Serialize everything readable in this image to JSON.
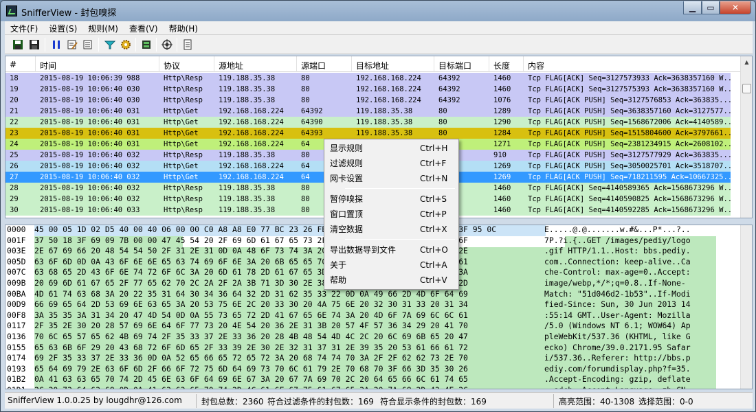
{
  "window": {
    "title": "SnifferView - 封包嗅探"
  },
  "menu": [
    "文件(F)",
    "设置(S)",
    "规则(M)",
    "查看(V)",
    "帮助(H)"
  ],
  "table": {
    "headers": [
      "#",
      "时间",
      "协议",
      "源地址",
      "源端口",
      "目标地址",
      "目标端口",
      "长度",
      "内容"
    ],
    "rows": [
      {
        "c": [
          "18",
          "2015-08-19 10:06:39 988",
          "Http\\Resp",
          "119.188.35.38",
          "80",
          "192.168.168.224",
          "64392",
          "1460",
          "Tcp FLAG[ACK] Seq=3127573933 Ack=3638357160 W..."
        ],
        "bg": "#c8c8f5"
      },
      {
        "c": [
          "19",
          "2015-08-19 10:06:40 030",
          "Http\\Resp",
          "119.188.35.38",
          "80",
          "192.168.168.224",
          "64392",
          "1460",
          "Tcp FLAG[ACK] Seq=3127575393 Ack=3638357160 W..."
        ],
        "bg": "#c8c8f5"
      },
      {
        "c": [
          "20",
          "2015-08-19 10:06:40 030",
          "Http\\Resp",
          "119.188.35.38",
          "80",
          "192.168.168.224",
          "64392",
          "1076",
          "Tcp FLAG[ACK PUSH] Seq=3127576853 Ack=363835..."
        ],
        "bg": "#c8c8f5"
      },
      {
        "c": [
          "21",
          "2015-08-19 10:06:40 031",
          "Http\\Get",
          "192.168.168.224",
          "64392",
          "119.188.35.38",
          "80",
          "1289",
          "Tcp FLAG[ACK PUSH] Seq=3638357160 Ack=3127577..."
        ],
        "bg": "#c8c8f5"
      },
      {
        "c": [
          "22",
          "2015-08-19 10:06:40 031",
          "Http\\Get",
          "192.168.168.224",
          "64390",
          "119.188.35.38",
          "80",
          "1290",
          "Tcp FLAG[ACK PUSH] Seq=1568672006 Ack=4140589..."
        ],
        "bg": "#c9f0c9"
      },
      {
        "c": [
          "23",
          "2015-08-19 10:06:40 031",
          "Http\\Get",
          "192.168.168.224",
          "64393",
          "119.188.35.38",
          "80",
          "1284",
          "Tcp FLAG[ACK PUSH] Seq=1515804600 Ack=3797661..."
        ],
        "bg": "#d8c010"
      },
      {
        "c": [
          "24",
          "2015-08-19 10:06:40 031",
          "Http\\Get",
          "192.168.168.224",
          "64",
          "",
          "",
          "1271",
          "Tcp FLAG[ACK PUSH] Seq=2381234915 Ack=2608102..."
        ],
        "bg": "#bff07a"
      },
      {
        "c": [
          "25",
          "2015-08-19 10:06:40 032",
          "Http\\Resp",
          "119.188.35.38",
          "80",
          "",
          "",
          "910",
          "Tcp FLAG[ACK PUSH] Seq=3127577929 Ack=363835..."
        ],
        "bg": "#c8c8f5"
      },
      {
        "c": [
          "26",
          "2015-08-19 10:06:40 032",
          "Http\\Get",
          "192.168.168.224",
          "64",
          "",
          "",
          "1269",
          "Tcp FLAG[ACK PUSH] Seq=3050025701 Ack=3518707..."
        ],
        "bg": "#b4dff5"
      },
      {
        "c": [
          "27",
          "2015-08-19 10:06:40 032",
          "Http\\Get",
          "192.168.168.224",
          "64",
          "",
          "",
          "1269",
          "Tcp FLAG[ACK PUSH] Seq=718211595 Ack=10667325..."
        ],
        "bg": "#3399ff",
        "sel": true
      },
      {
        "c": [
          "28",
          "2015-08-19 10:06:40 032",
          "Http\\Resp",
          "119.188.35.38",
          "80",
          "",
          "",
          "1460",
          "Tcp FLAG[ACK] Seq=4140589365 Ack=1568673296 W..."
        ],
        "bg": "#c9f0c9"
      },
      {
        "c": [
          "29",
          "2015-08-19 10:06:40 032",
          "Http\\Resp",
          "119.188.35.38",
          "80",
          "",
          "",
          "1460",
          "Tcp FLAG[ACK] Seq=4140590825 Ack=1568673296 W..."
        ],
        "bg": "#c9f0c9"
      },
      {
        "c": [
          "30",
          "2015-08-19 10:06:40 033",
          "Http\\Resp",
          "119.188.35.38",
          "80",
          "",
          "",
          "1460",
          "Tcp FLAG[ACK] Seq=4140592285 Ack=1568673296 W..."
        ],
        "bg": "#c9f0c9"
      }
    ]
  },
  "hex": [
    {
      "o": "0000",
      "b": "45 00 05 1D 02 D5 40 00 40 06 00 00 C0 A8 A8 E0 77 BC 23 26 FB 8F 00 50 BE 8E 99 89 0A 0B 3F 95 0C",
      "a": "E.....@.@.......w.#&...P*...?.."
    },
    {
      "o": "001F",
      "b": "37 50 18 3F 69 09 7B 00 00 47 45 54 20 2F 69 6D 61 67 65 73 2F 70 65 64 69 79 2F 6C 6F 67 6F",
      "a": "7P.?i.{..GET /images/pediy/logo"
    },
    {
      "o": "003E",
      "b": "2E 67 69 66 20 48 54 54 50 2F 31 2E 31 0D 0A 48 6F 73 74 3A 20 62 62 73 2E 70 65 64 69 79 2E",
      "a": ".gif HTTP/1.1..Host: bbs.pediy."
    },
    {
      "o": "005D",
      "b": "63 6F 6D 0D 0A 43 6F 6E 6E 65 63 74 69 6F 6E 3A 20 6B 65 65 70 2D 61 6C 69 76 65 0D 0A 43 61",
      "a": "com..Connection: keep-alive..Ca"
    },
    {
      "o": "007C",
      "b": "63 68 65 2D 43 6F 6E 74 72 6F 6C 3A 20 6D 61 78 2D 61 67 65 3D 30 0D 0A 41 63 63 65 70 74 3A",
      "a": "che-Control: max-age=0..Accept:"
    },
    {
      "o": "009B",
      "b": "20 69 6D 61 67 65 2F 77 65 62 70 2C 2A 2F 2A 3B 71 3D 30 2E 38 0D 0A 49 66 2D 4E 6F 6E 65 2D",
      "a": " image/webp,*/*;q=0.8..If-None-"
    },
    {
      "o": "00BA",
      "b": "4D 61 74 63 68 3A 20 22 35 31 64 30 34 36 64 32 2D 31 62 35 33 22 0D 0A 49 66 2D 4D 6F 64 69",
      "a": "Match: \"51d046d2-1b53\"..If-Modi"
    },
    {
      "o": "00D9",
      "b": "66 69 65 64 2D 53 69 6E 63 65 3A 20 53 75 6E 2C 20 33 30 20 4A 75 6E 20 32 30 31 33 20 31 34",
      "a": "fied-Since: Sun, 30 Jun 2013 14"
    },
    {
      "o": "00F8",
      "b": "3A 35 35 3A 31 34 20 47 4D 54 0D 0A 55 73 65 72 2D 41 67 65 6E 74 3A 20 4D 6F 7A 69 6C 6C 61",
      "a": ":55:14 GMT..User-Agent: Mozilla"
    },
    {
      "o": "0117",
      "b": "2F 35 2E 30 20 28 57 69 6E 64 6F 77 73 20 4E 54 20 36 2E 31 3B 20 57 4F 57 36 34 29 20 41 70",
      "a": "/5.0 (Windows NT 6.1; WOW64) Ap"
    },
    {
      "o": "0136",
      "b": "70 6C 65 57 65 62 4B 69 74 2F 35 33 37 2E 33 36 20 28 4B 48 54 4D 4C 2C 20 6C 69 6B 65 20 47",
      "a": "pleWebKit/537.36 (KHTML, like G"
    },
    {
      "o": "0155",
      "b": "65 63 6B 6F 29 20 43 68 72 6F 6D 65 2F 33 39 2E 30 2E 32 31 37 31 2E 39 35 20 53 61 66 61 72",
      "a": "ecko) Chrome/39.0.2171.95 Safar"
    },
    {
      "o": "0174",
      "b": "69 2F 35 33 37 2E 33 36 0D 0A 52 65 66 65 72 65 72 3A 20 68 74 74 70 3A 2F 2F 62 62 73 2E 70",
      "a": "i/537.36..Referer: http://bbs.p"
    },
    {
      "o": "0193",
      "b": "65 64 69 79 2E 63 6F 6D 2F 66 6F 72 75 6D 64 69 73 70 6C 61 79 2E 70 68 70 3F 66 3D 35 30 26",
      "a": "ediy.com/forumdisplay.php?f=35."
    },
    {
      "o": "01B2",
      "b": "0A 41 63 63 65 70 74 2D 45 6E 63 6F 64 69 6E 67 3A 20 67 7A 69 70 2C 20 64 65 66 6C 61 74 65",
      "a": ".Accept-Encoding: gzip, deflate"
    },
    {
      "o": "01D1",
      "b": "2C 20 73 64 63 68 0D 0A 41 63 63 65 70 74 2D 4C 61 6E 67 75 61 67 65 3A 20 7A 68 2D 43 4E 2C",
      "a": ", sdch..Accept-Language: zh-CN,"
    },
    {
      "o": "01F0",
      "b": "7A 68 3B 71 3D 30 2E 38 0D 0A 43 6F 6F 6B 69 65 3A 20 49 44 73 74 61 63 6B 3D 25 32 43 34 36",
      "a": "zh;q=0.8..Cookie: IDstack=%2C46"
    },
    {
      "o": "020F",
      "b": "38 37 32 38 25 32 43 3B 20 76 62 75 6C 6C 65 74 69 6E 5F 63 6F 6C 6C 61 70 73 65 3D 61 74 74",
      "a": "8728%2C; vbulletin_collapse=att"
    }
  ],
  "context_menu": [
    {
      "label": "显示规则",
      "shortcut": "Ctrl+H"
    },
    {
      "label": "过滤规则",
      "shortcut": "Ctrl+F"
    },
    {
      "label": "网卡设置",
      "shortcut": "Ctrl+N"
    },
    {
      "label": "暂停嗅探",
      "shortcut": "Ctrl+S"
    },
    {
      "label": "窗口置顶",
      "shortcut": "Ctrl+P"
    },
    {
      "label": "清空数据",
      "shortcut": "Ctrl+X"
    },
    {
      "label": "导出数据导到文件",
      "shortcut": "Ctrl+O"
    },
    {
      "label": "关于",
      "shortcut": "Ctrl+A"
    },
    {
      "label": "帮助",
      "shortcut": "Ctrl+V"
    }
  ],
  "status": {
    "app": "SnifferView  1.0.0.25  by  lougdhr@126.com",
    "total": "封包总数：2360",
    "filter": "符合过滤条件的封包数：169",
    "display": "符合显示条件的封包数：169",
    "range": "高亮范围：40-1308",
    "select": "选择范围：0-0"
  },
  "icons": [
    "save-icon",
    "save-all-icon",
    "pause-icon",
    "edit-icon",
    "filter-edit-icon",
    "filter-icon",
    "gear-icon",
    "adapter-icon",
    "target-icon",
    "document-icon"
  ]
}
